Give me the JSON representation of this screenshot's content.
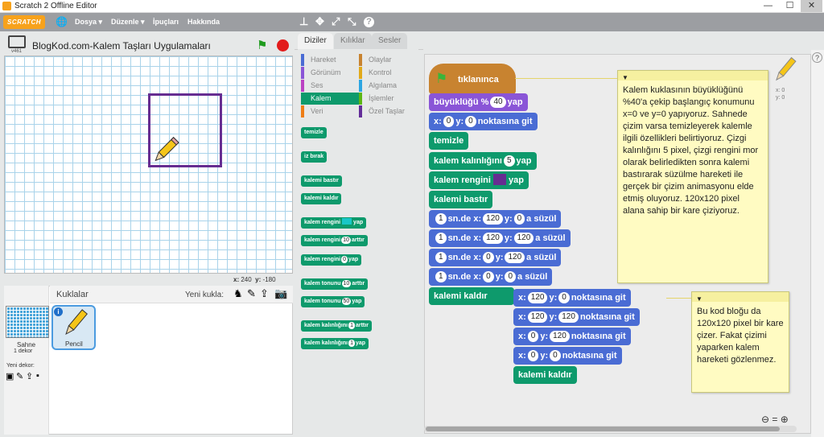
{
  "window": {
    "title": "Scratch 2 Offline Editor"
  },
  "menu": {
    "logo": "SCRATCH",
    "file": "Dosya ▾",
    "edit": "Düzenle ▾",
    "tips": "İpuçları",
    "about": "Hakkında"
  },
  "stage": {
    "title": "BlogKod.com-Kalem Taşları Uygulamaları",
    "version": "v461",
    "mouse_x_label": "x:",
    "mouse_x": "240",
    "mouse_y_label": "y:",
    "mouse_y": "-180"
  },
  "sprites": {
    "header": "Kuklalar",
    "new_sprite": "Yeni kukla:",
    "stage_label": "Sahne",
    "stage_sub": "1 dekor",
    "new_backdrop": "Yeni dekor:",
    "pencil": "Pencil"
  },
  "tabs": {
    "scripts": "Diziler",
    "costumes": "Kılıklar",
    "sounds": "Sesler"
  },
  "categories": [
    {
      "label": "Hareket",
      "color": "#4a6cd4"
    },
    {
      "label": "Olaylar",
      "color": "#c88330"
    },
    {
      "label": "Görünüm",
      "color": "#8a55d7"
    },
    {
      "label": "Kontrol",
      "color": "#e1a91a"
    },
    {
      "label": "Ses",
      "color": "#bb42c3"
    },
    {
      "label": "Algılama",
      "color": "#2ca5e2"
    },
    {
      "label": "Kalem",
      "color": "#0e9a6c"
    },
    {
      "label": "İşlemler",
      "color": "#5cb712"
    },
    {
      "label": "Veri",
      "color": "#ee7d16"
    },
    {
      "label": "Özel Taşlar",
      "color": "#632d99"
    }
  ],
  "palette": {
    "clear": "temizle",
    "stamp": "iz bırak",
    "pen_down": "kalemi bastır",
    "pen_up": "kalemi kaldır",
    "color_set_a": "kalem rengini",
    "color_set_b": "yap",
    "color_change_a": "kalem rengini",
    "color_change_v": "10",
    "color_change_b": "arttır",
    "color_to_a": "kalem rengini",
    "color_to_v": "0",
    "color_to_b": "yap",
    "shade_change_a": "kalem tonunu",
    "shade_change_v": "10",
    "shade_change_b": "arttır",
    "shade_to_a": "kalem tonunu",
    "shade_to_v": "50",
    "shade_to_b": "yap",
    "size_change_a": "kalem kalınlığını",
    "size_change_v": "1",
    "size_change_b": "arttır",
    "size_to_a": "kalem kalınlığını",
    "size_to_v": "1",
    "size_to_b": "yap"
  },
  "script": {
    "hat": "tıklanınca",
    "size_a": "büyüklüğü",
    "size_pct": "%",
    "size_v": "40",
    "size_b": "yap",
    "goto_x": "x:",
    "goto_xv": "0",
    "goto_y": "y:",
    "goto_yv": "0",
    "goto_b": "noktasına git",
    "clear": "temizle",
    "width_a": "kalem kalınlığını",
    "width_v": "5",
    "width_b": "yap",
    "color_a": "kalem rengini",
    "color_b": "yap",
    "pen_color": "#662d91",
    "pen_down": "kalemi bastır",
    "glide": [
      {
        "t": "1",
        "x": "120",
        "y": "0"
      },
      {
        "t": "1",
        "x": "120",
        "y": "120"
      },
      {
        "t": "1",
        "x": "0",
        "y": "120"
      },
      {
        "t": "1",
        "x": "0",
        "y": "0"
      }
    ],
    "glide_a": "sn.de x:",
    "glide_y": "y:",
    "glide_b": "a süzül",
    "pen_up": "kalemi kaldır",
    "gotos": [
      {
        "x": "120",
        "y": "0"
      },
      {
        "x": "120",
        "y": "120"
      },
      {
        "x": "0",
        "y": "120"
      },
      {
        "x": "0",
        "y": "0"
      }
    ],
    "goto_label_x": "x:",
    "goto_label_y": "y:",
    "goto_label_b": "noktasına git",
    "pen_up2": "kalemi kaldır"
  },
  "notes": {
    "note1": "Kalem kuklasının büyüklüğünü %40'a çekip başlangıç konumunu x=0 ve y=0 yapıyoruz. Sahnede çizim varsa temizleyerek kalemle ilgili özellikleri belirtiyoruz. Çizgi kalınlığını 5 pixel, çizgi rengini mor olarak belirledikten sonra kalemi bastırarak süzülme hareketi ile gerçek bir çizim animasyonu elde etmiş oluyoruz. 120x120 pixel alana sahip bir kare çiziyoruz.",
    "note2": "Bu kod bloğu da 120x120 pixel bir kare çizer. Fakat çizimi yaparken kalem hareketi gözlenmez."
  },
  "sprite_info": {
    "x": "x: 0",
    "y": "y: 0"
  },
  "colors": {
    "pen": "#0e9a6c",
    "motion": "#4a6cd4",
    "looks": "#8a55d7",
    "events": "#c88330",
    "square": "#662d91"
  }
}
